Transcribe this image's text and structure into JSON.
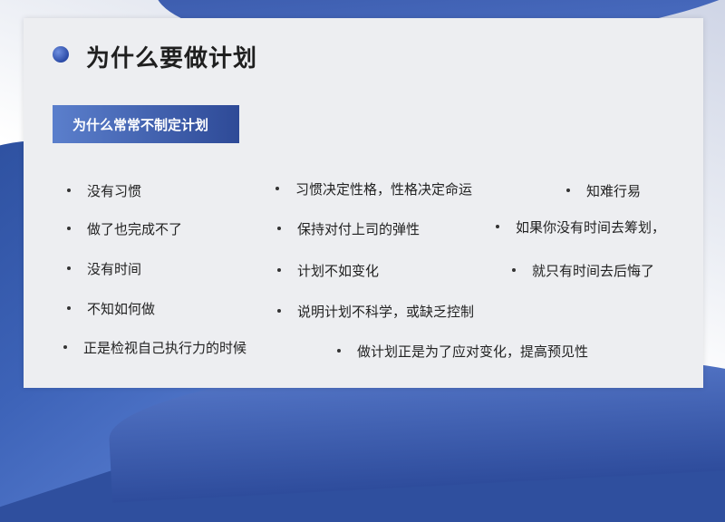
{
  "title": "为什么要做计划",
  "subtitle": "为什么常常不制定计划",
  "columns": {
    "left": [
      "没有习惯",
      "做了也完成不了",
      "没有时间",
      "不知如何做",
      "正是检视自己执行力的时候"
    ],
    "middle": [
      "习惯决定性格，性格决定命运",
      "保持对付上司的弹性",
      "计划不如变化",
      "说明计划不科学，或缺乏控制",
      "做计划正是为了应对变化，提高预见性"
    ],
    "right": [
      "知难行易",
      "如果你没有时间去筹划，",
      "就只有时间去后悔了"
    ]
  },
  "colors": {
    "accent": "#2e4a97",
    "accent_light": "#5b7fcc"
  }
}
